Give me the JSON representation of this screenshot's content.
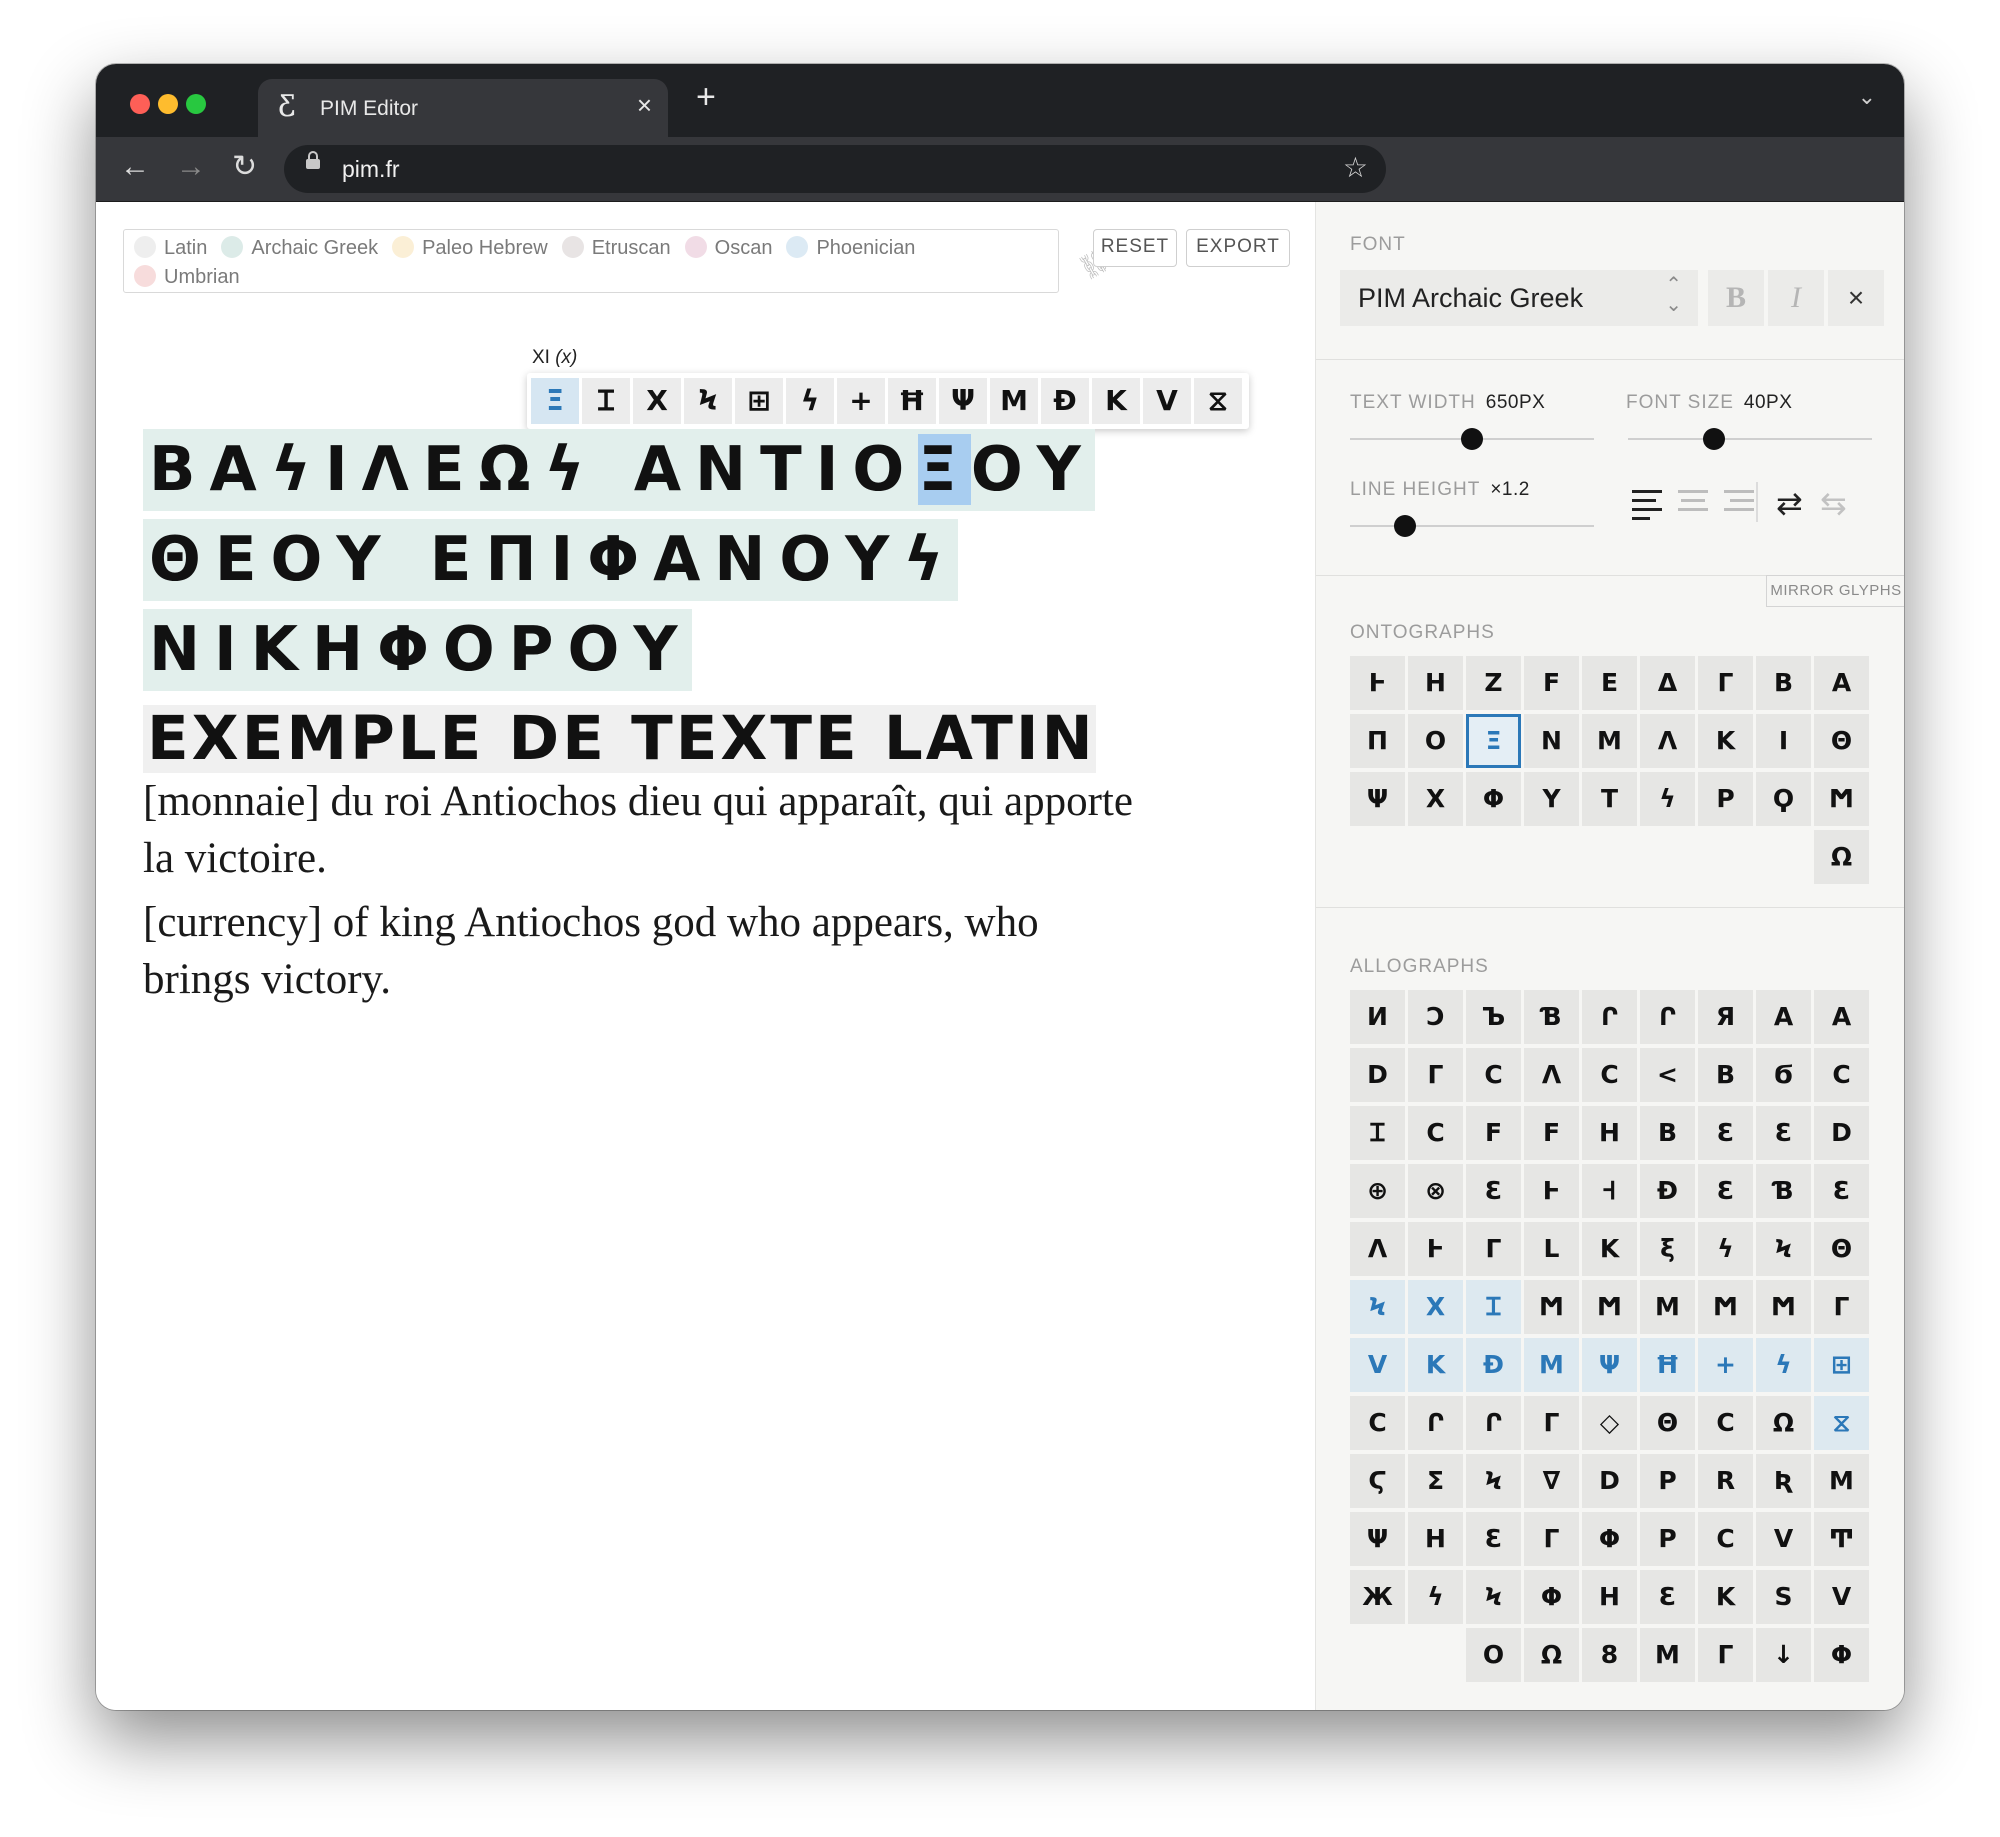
{
  "browser": {
    "tab_title": "PIM Editor",
    "tab_logo": "Ƹ",
    "url": "pim.fr",
    "icons": {
      "back": "←",
      "forward": "→",
      "reload": "↻",
      "star": "☆",
      "close": "×",
      "new_tab": "+",
      "tab_menu": "⌄"
    }
  },
  "legend": {
    "items": [
      {
        "label": "Latin",
        "color": "#eeeeee"
      },
      {
        "label": "Archaic Greek",
        "color": "#dcebe8"
      },
      {
        "label": "Paleo Hebrew",
        "color": "#fbefd6"
      },
      {
        "label": "Etruscan",
        "color": "#e8e4e4"
      },
      {
        "label": "Oscan",
        "color": "#f1dce6"
      },
      {
        "label": "Phoenician",
        "color": "#dceaf4"
      },
      {
        "label": "Umbrian",
        "color": "#f7dcdc"
      }
    ],
    "reset_label": "RESET",
    "export_label": "EXPORT",
    "link_icon": "⛓"
  },
  "glyph_picker": {
    "title": "XI",
    "subtitle": "(x)",
    "glyphs": [
      "Ξ",
      "Ɪ",
      "X",
      "Ϟ",
      "⊞",
      "ϟ",
      "+",
      "Ħ",
      "Ψ",
      "M",
      "Ð",
      "K",
      "V",
      "⧖"
    ],
    "selected_index": 0
  },
  "editor": {
    "greek_lines": [
      {
        "before": "ΒΑϟΙΛΕΩϟ ΑΝΤΙΟ",
        "highlight": "Ξ",
        "after": "ΟΥ"
      },
      {
        "before": "ΘΕΟΥ ΕΠΙΦΑΝΟΥϟ",
        "highlight": "",
        "after": ""
      },
      {
        "before": "ΝΙΚΗΦΟΡΟΥ",
        "highlight": "",
        "after": ""
      }
    ],
    "latin_line": "EXEMPLE DE TEXTE LATIN",
    "french_text": "[monnaie] du roi Antiochos dieu qui apparaît, qui apporte la victoire.",
    "english_text": "[currency] of king Antiochos god who appears, who brings victory."
  },
  "panel": {
    "font_label": "FONT",
    "font_name": "PIM Archaic Greek",
    "bold_label": "B",
    "italic_label": "I",
    "close_label": "×",
    "text_width_label": "TEXT WIDTH",
    "text_width_value": "650PX",
    "text_width_level": 0.5,
    "font_size_label": "FONT SIZE",
    "font_size_value": "40PX",
    "font_size_level": 0.34,
    "line_height_label": "LINE HEIGHT",
    "line_height_value": "×1.2",
    "line_height_level": 0.2,
    "mirror_label": "MIRROR GLYPHS",
    "direction_icons": {
      "ltr": "⇄",
      "rtl": "⇆"
    },
    "ontographs_label": "ONTOGRAPHS",
    "ontographs": [
      "Ͱ",
      "Η",
      "Ζ",
      "F",
      "Ε",
      "Δ",
      "Γ",
      "Β",
      "Α",
      "Π",
      "Ο",
      "Ξ",
      "Ν",
      "Μ",
      "Λ",
      "Κ",
      "Ι",
      "Θ",
      "Ψ",
      "Χ",
      "Φ",
      "Υ",
      "Τ",
      "ϟ",
      "Ρ",
      "Ϙ",
      "Ϻ",
      "",
      "",
      "",
      "",
      "",
      "",
      "",
      "",
      "Ω"
    ],
    "ontographs_selected": 11,
    "allographs_label": "ALLOGRAPHS",
    "allographs": [
      "И",
      "Ɔ",
      "Ъ",
      "Ɓ",
      "Ր",
      "Ր",
      "Я",
      "Α",
      "Α",
      "D",
      "Γ",
      "Ϲ",
      "Λ",
      "C",
      "<",
      "Β",
      "Ϭ",
      "C",
      "Ɪ",
      "Ϲ",
      "F",
      "F",
      "Η",
      "B",
      "Ɛ",
      "Ɛ",
      "D",
      "⊕",
      "⊗",
      "Ɛ",
      "Ͱ",
      "Ꟶ",
      "Ð",
      "Ɛ",
      "Ɓ",
      "Ɛ",
      "Λ",
      "Ͱ",
      "Γ",
      "L",
      "Κ",
      "ξ",
      "ϟ",
      "Ϟ",
      "Θ",
      "Ϟ",
      "Χ",
      "Ɪ",
      "Ϻ",
      "Ϻ",
      "Μ",
      "Ϻ",
      "Ϻ",
      "Γ",
      "V",
      "Κ",
      "Ð",
      "Μ",
      "Ψ",
      "Ħ",
      "+",
      "ϟ",
      "⊞",
      "Ϲ",
      "Ր",
      "Ր",
      "Γ",
      "◇",
      "Θ",
      "C",
      "Ω",
      "⧖",
      "Ϛ",
      "Σ",
      "Ϟ",
      "∇",
      "D",
      "Ρ",
      "R",
      "Ʀ",
      "Μ",
      "Ψ",
      "Η",
      "Ɛ",
      "Γ",
      "Φ",
      "Ρ",
      "Ϲ",
      "V",
      "Ͳ",
      "Ж",
      "ϟ",
      "Ϟ",
      "Φ",
      "Η",
      "Ɛ",
      "Κ",
      "S",
      "V",
      "",
      "",
      "Ο",
      "Ω",
      "8",
      "Μ",
      "Γ",
      "↓",
      "Φ"
    ],
    "allographs_blue": [
      45,
      46,
      47,
      54,
      55,
      56,
      57,
      58,
      59,
      60,
      61,
      62,
      71
    ]
  }
}
